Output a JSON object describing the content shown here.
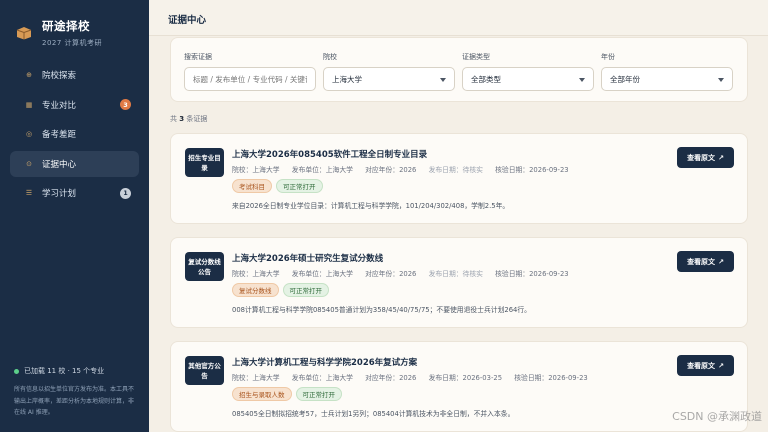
{
  "brand": {
    "title": "研途择校",
    "subtitle": "2027 计算机考研"
  },
  "nav": [
    {
      "label": "院校探索",
      "icon": "⊕",
      "badge": ""
    },
    {
      "label": "专业对比",
      "icon": "▦",
      "badge": "3"
    },
    {
      "label": "备考差距",
      "icon": "◎",
      "badge": ""
    },
    {
      "label": "证据中心",
      "icon": "⊙",
      "badge": ""
    },
    {
      "label": "学习计划",
      "icon": "☰",
      "badge": "1"
    }
  ],
  "sidebar_footer": {
    "status": "已加载 11 校 · 15 个专业",
    "note": "所有信息以招生单位官方发布为准。本工具不输出上岸概率，差距分析为本地规则计算，非在线 AI 推理。"
  },
  "page_title": "证据中心",
  "filters": {
    "search": {
      "label": "搜索证据",
      "placeholder": "标题 / 发布单位 / 专业代码 / 关键词"
    },
    "school": {
      "label": "院校",
      "value": "上海大学"
    },
    "type": {
      "label": "证据类型",
      "value": "全部类型"
    },
    "year": {
      "label": "年份",
      "value": "全部年份"
    }
  },
  "result_count": {
    "prefix": "共",
    "number": "3",
    "suffix": "条证据"
  },
  "view_label": "查看原文",
  "cards": [
    {
      "tag": "招生专业目录",
      "title": "上海大学2026年085405软件工程全日制专业目录",
      "school": "院校：上海大学",
      "publisher": "发布单位：上海大学",
      "year": "对应年份：2026",
      "publish_date": "发布日期：待核实",
      "verify_date": "核验日期：2026-09-23",
      "chips": [
        "考试科目",
        "可正常打开"
      ],
      "desc": "来自2026全日制专业学位目录：计算机工程与科学学院，101/204/302/408，学制2.5年。"
    },
    {
      "tag": "复试分数线公告",
      "title": "上海大学2026年硕士研究生复试分数线",
      "school": "院校：上海大学",
      "publisher": "发布单位：上海大学",
      "year": "对应年份：2026",
      "publish_date": "发布日期：待核实",
      "verify_date": "核验日期：2026-09-23",
      "chips": [
        "复试分数线",
        "可正常打开"
      ],
      "desc": "008计算机工程与科学学院085405普通计划为358/45/40/75/75；不要使用退役士兵计划264行。"
    },
    {
      "tag": "其他官方公告",
      "title": "上海大学计算机工程与科学学院2026年复试方案",
      "school": "院校：上海大学",
      "publisher": "发布单位：上海大学",
      "year": "对应年份：2026",
      "publish_date": "发布日期：2026-03-25",
      "verify_date": "核验日期：2026-09-23",
      "chips": [
        "招生与录取人数",
        "可正常打开"
      ],
      "desc": "085405全日制拟招统考57，士兵计划1另列；085404计算机技术为非全日制，不并入本条。"
    }
  ],
  "watermark": "CSDN @承渊政道",
  "colors": {
    "navy": "#1b2d45",
    "accent_orange": "#e07a45",
    "background": "#f4efe6"
  }
}
